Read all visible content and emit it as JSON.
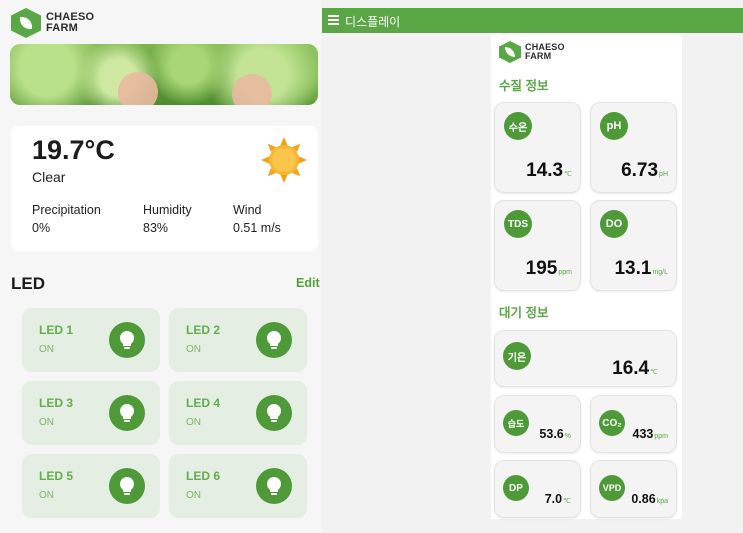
{
  "left": {
    "logo_line1": "CHAESO",
    "logo_line2": "FARM",
    "weather": {
      "temperature": "19.7°C",
      "condition": "Clear",
      "precipitation_label": "Precipitation",
      "precipitation_value": "0%",
      "humidity_label": "Humidity",
      "humidity_value": "83%",
      "wind_label": "Wind",
      "wind_value": "0.51 m/s"
    },
    "led_title": "LED",
    "edit_label": "Edit",
    "leds": [
      {
        "name": "LED 1",
        "state": "ON"
      },
      {
        "name": "LED 2",
        "state": "ON"
      },
      {
        "name": "LED 3",
        "state": "ON"
      },
      {
        "name": "LED 4",
        "state": "ON"
      },
      {
        "name": "LED 5",
        "state": "ON"
      },
      {
        "name": "LED 6",
        "state": "ON"
      }
    ]
  },
  "right": {
    "appbar_title": "디스플레이",
    "logo_line1": "CHAESO",
    "logo_line2": "FARM",
    "water_section": "수질 정보",
    "air_section": "대기 정보",
    "water_cards": [
      {
        "badge": "수온",
        "value": "14.3",
        "unit": "℃"
      },
      {
        "badge": "pH",
        "value": "6.73",
        "unit": "pH"
      },
      {
        "badge": "TDS",
        "value": "195",
        "unit": "ppm"
      },
      {
        "badge": "DO",
        "value": "13.1",
        "unit": "mg/L"
      }
    ],
    "air_temp": {
      "badge": "기온",
      "value": "16.4",
      "unit": "℃"
    },
    "air_cards": [
      {
        "badge": "습도",
        "value": "53.6",
        "unit": "%"
      },
      {
        "badge": "CO₂",
        "value": "433",
        "unit": "ppm"
      },
      {
        "badge": "DP",
        "value": "7.0",
        "unit": "℃"
      },
      {
        "badge": "VPD",
        "value": "0.86",
        "unit": "kpa"
      }
    ]
  },
  "colors": {
    "brand_green": "#5aa845",
    "badge_green": "#4f9a38",
    "led_card_bg": "#e4eee2"
  }
}
